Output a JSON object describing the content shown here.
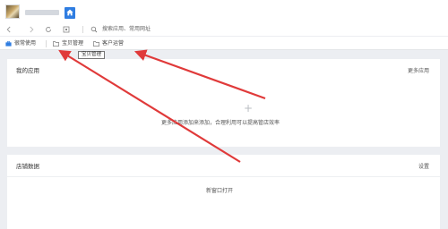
{
  "toolbar": {
    "search_text": "搜索应用、常用网址"
  },
  "bookmarks": [
    {
      "label": "很常使用"
    },
    {
      "label": "宝贝管理"
    },
    {
      "label": "客户运营"
    }
  ],
  "tooltip": {
    "text": "宝贝管理"
  },
  "apps_panel": {
    "title": "我的应用",
    "more": "更多应用",
    "empty_hint": "更多应用添加来添加，合理利用可以提高管店效率"
  },
  "shop_panel": {
    "title": "店铺数据",
    "settings": "设置",
    "new_window": "新窗口打开"
  },
  "colors": {
    "accent": "#2f7de1",
    "annotation_arrow": "#e03a3a",
    "background": "#eceef2"
  },
  "icons": [
    "home-icon",
    "back-icon",
    "forward-icon",
    "refresh-icon",
    "qr-icon",
    "search-icon",
    "folder-icon"
  ]
}
